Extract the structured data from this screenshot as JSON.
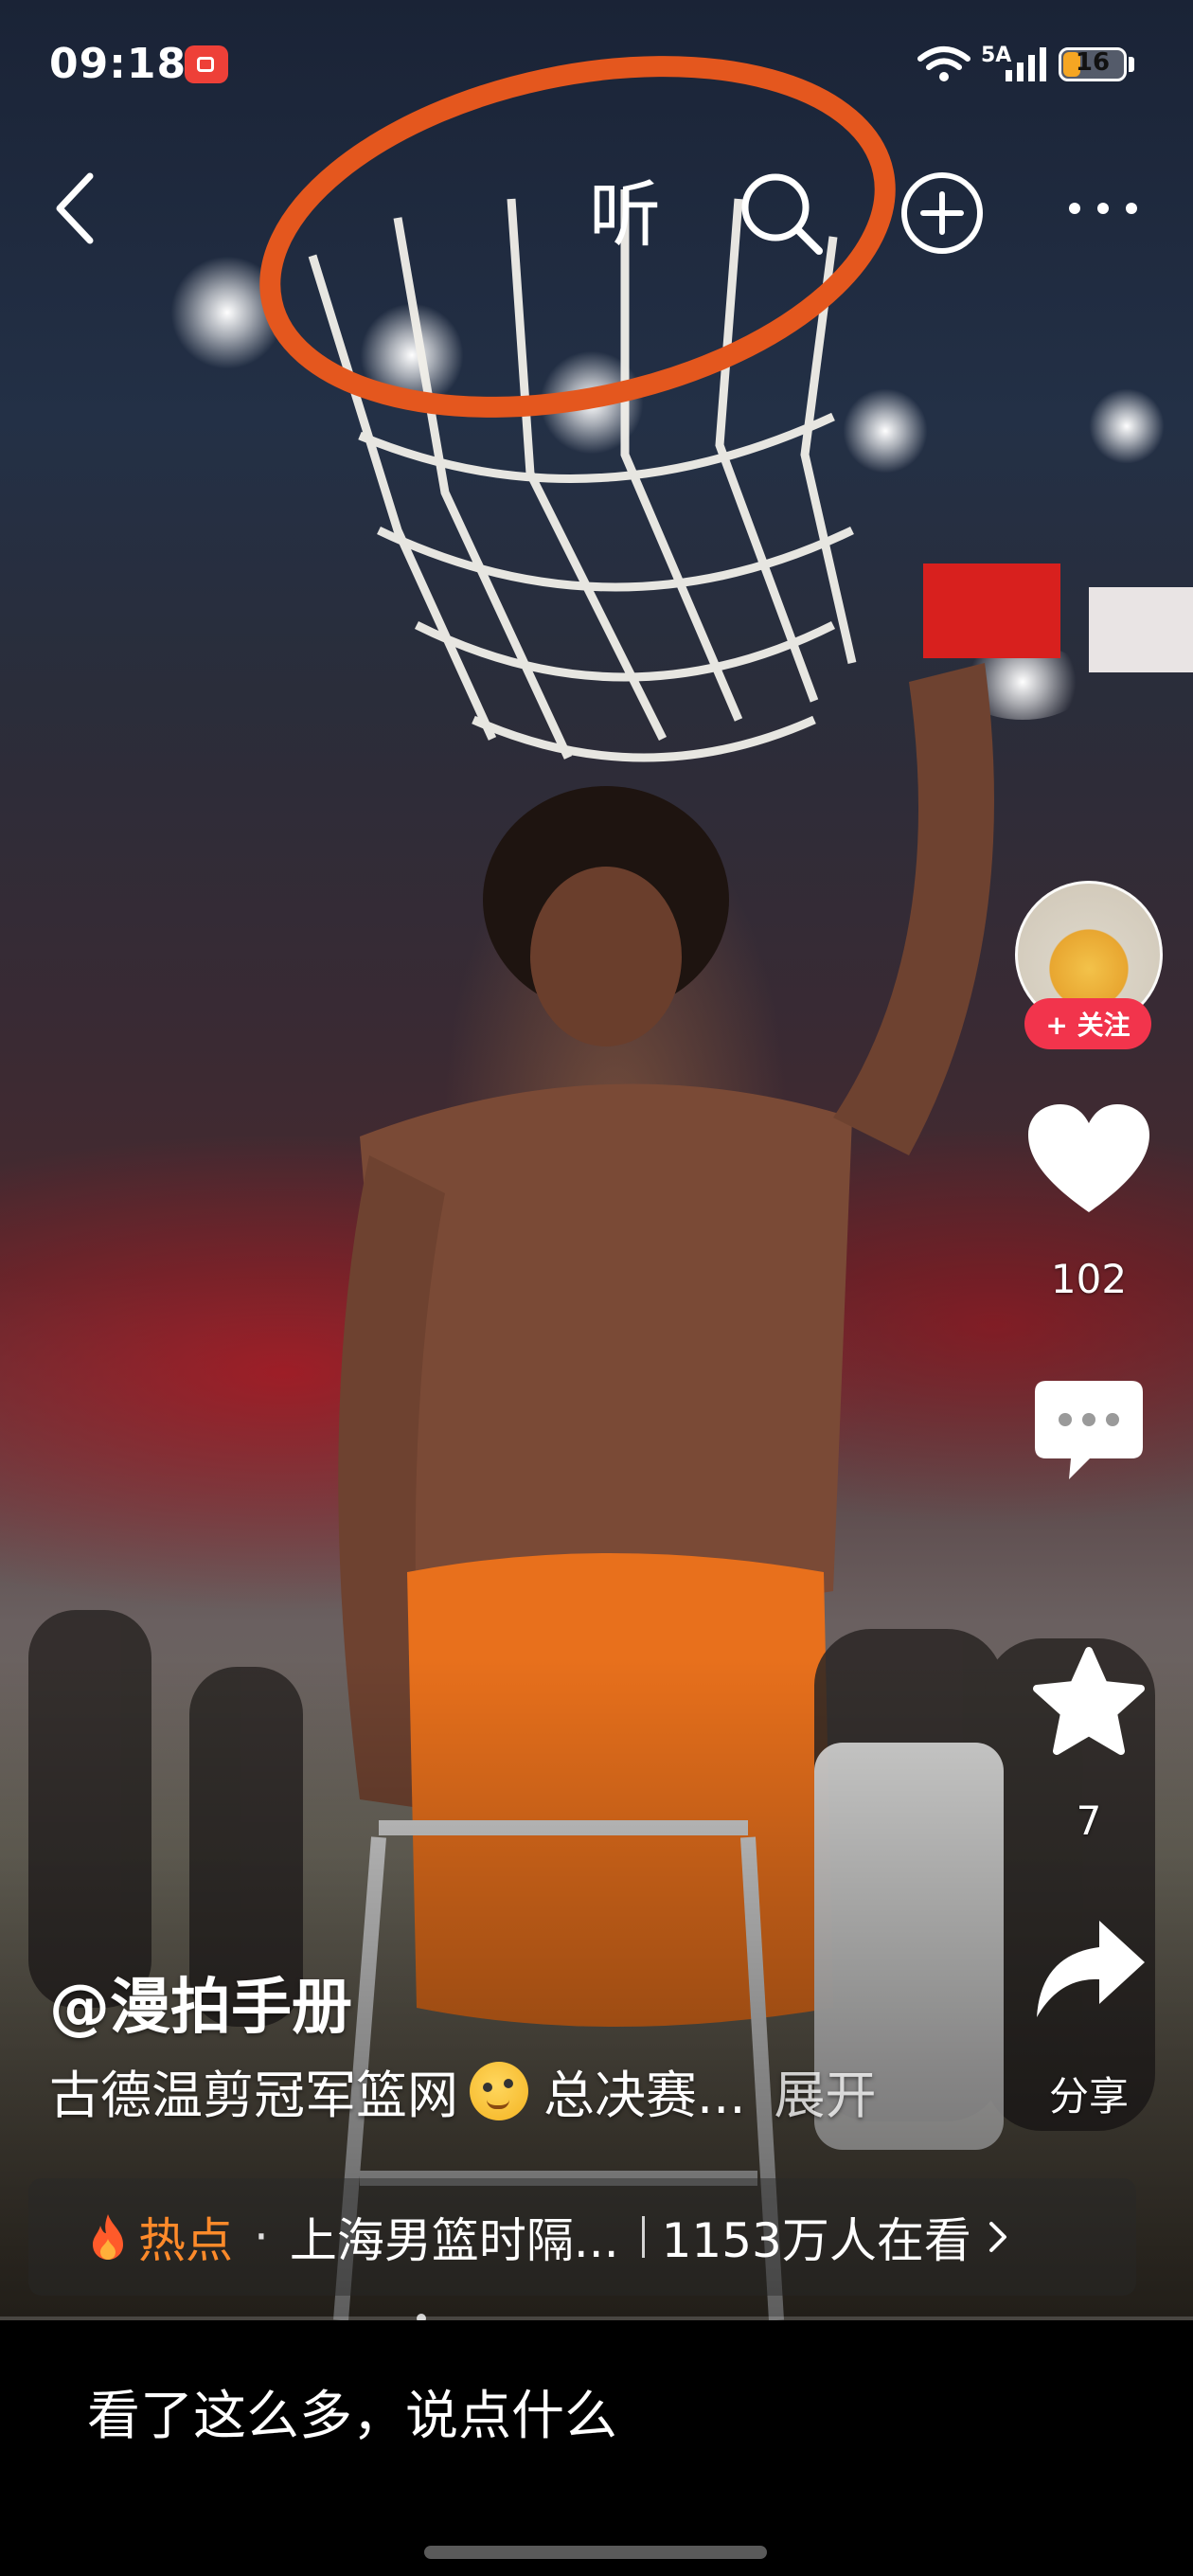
{
  "status_bar": {
    "time": "09:18",
    "signal_label": "5A",
    "battery": "16"
  },
  "top_bar": {
    "listen_label": "听"
  },
  "video": {
    "author": "@漫拍手册",
    "caption": "古德温剪冠军篮网",
    "caption_tail": "总决赛...",
    "expand_label": "展开"
  },
  "right_rail": {
    "follow_label": "+ 关注",
    "like_count": "102",
    "favorite_count": "7",
    "share_label": "分享"
  },
  "hot_banner": {
    "label": "热点",
    "separator": "·",
    "title": "上海男篮时隔...",
    "viewers": "1153万人在看"
  },
  "comment_bar": {
    "placeholder": "看了这么多，说点什么"
  },
  "colors": {
    "follow_red": "#f2344c",
    "hot_orange": "#ff8a2a",
    "record_red": "#ee4038"
  }
}
